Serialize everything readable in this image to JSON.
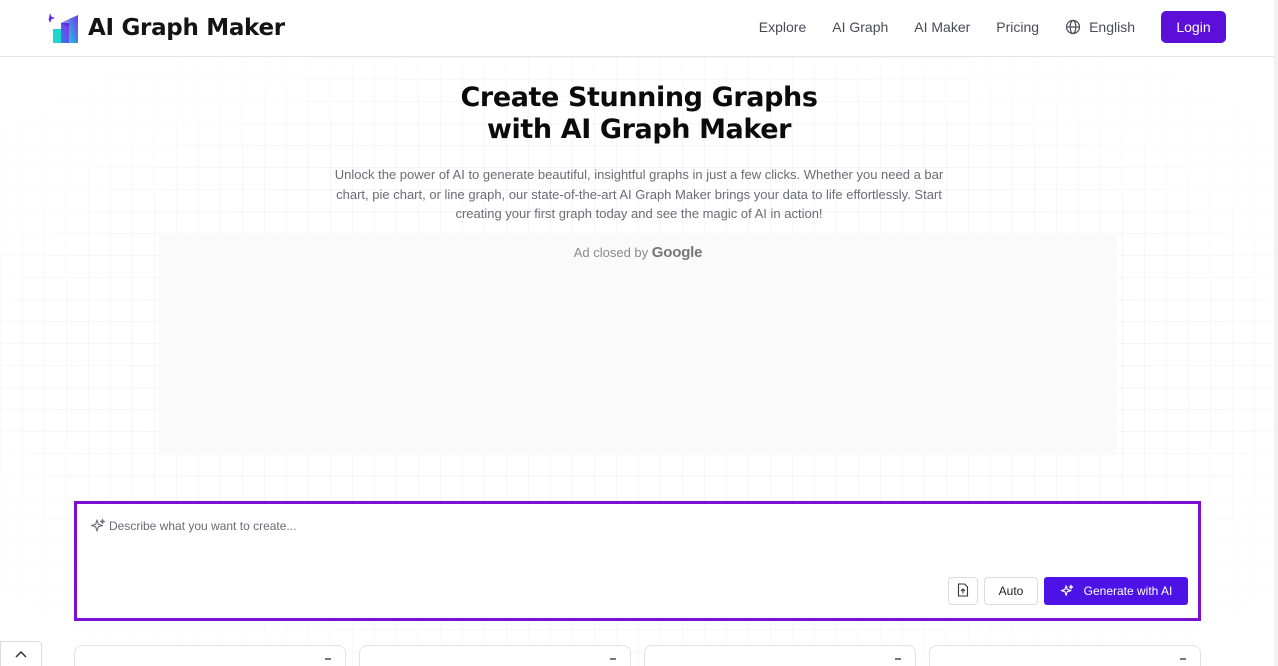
{
  "header": {
    "logo_text": "AI Graph Maker",
    "nav": [
      "Explore",
      "AI Graph",
      "AI Maker",
      "Pricing"
    ],
    "language": "English",
    "login_label": "Login"
  },
  "hero": {
    "title_line1": "Create Stunning Graphs",
    "title_line2": "with AI Graph Maker",
    "subtitle": "Unlock the power of AI to generate beautiful, insightful graphs in just a few clicks. Whether you need a bar chart, pie chart, or line graph, our state-of-the-art AI Graph Maker brings your data to life effortlessly. Start creating your first graph today and see the magic of AI in action!"
  },
  "ad": {
    "text": "Ad closed by",
    "brand": "Google"
  },
  "prompt": {
    "placeholder": "Describe what you want to create...",
    "value": "",
    "mode_label": "Auto",
    "generate_label": "Generate with AI"
  },
  "colors": {
    "accent": "#5b0fd9",
    "prompt_border": "#7a10d4",
    "generate_button": "#4c12e6"
  },
  "icons": {
    "logo": "bar-chart-sparkle-icon",
    "language": "globe-icon",
    "prompt": "sparkle-icon",
    "upload": "file-upload-icon",
    "generate": "sparkle-icon",
    "back_to_top": "chevron-up-icon"
  }
}
